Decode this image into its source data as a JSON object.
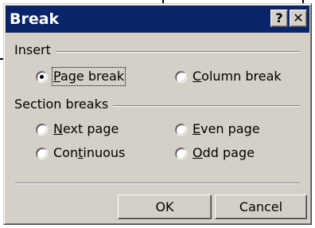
{
  "dialog": {
    "title": "Break",
    "help_label": "?",
    "close_label": "✕",
    "insert_group": {
      "label": "Insert",
      "options": [
        {
          "pre": "",
          "key": "P",
          "post": "age break",
          "checked": true
        },
        {
          "pre": "",
          "key": "C",
          "post": "olumn break",
          "checked": false
        }
      ]
    },
    "section_group": {
      "label": "Section breaks",
      "options": [
        {
          "pre": "",
          "key": "N",
          "post": "ext page",
          "checked": false
        },
        {
          "pre": "",
          "key": "E",
          "post": "ven page",
          "checked": false
        },
        {
          "pre": "Con",
          "key": "t",
          "post": "inuous",
          "checked": false
        },
        {
          "pre": "",
          "key": "O",
          "post": "dd page",
          "checked": false
        }
      ]
    },
    "ok_label": "OK",
    "cancel_label": "Cancel"
  }
}
